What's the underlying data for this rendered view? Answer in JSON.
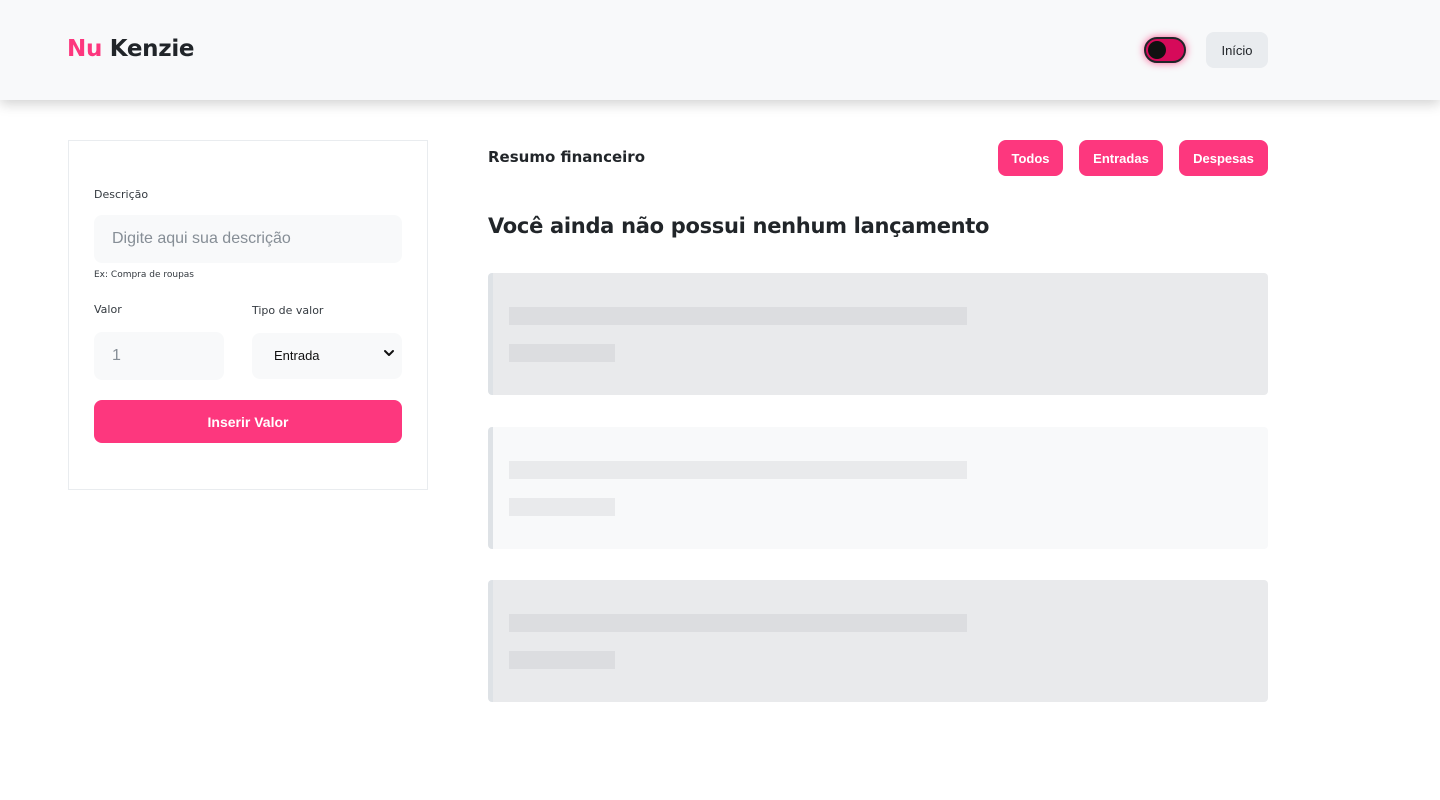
{
  "header": {
    "logo_primary": "Nu",
    "logo_secondary": "Kenzie",
    "theme_toggle_icon": "toggle-switch-icon",
    "home_button_label": "Início"
  },
  "form": {
    "description_label": "Descrição",
    "description_placeholder": "Digite aqui sua descrição",
    "description_hint": "Ex: Compra de roupas",
    "value_label": "Valor",
    "value_placeholder": "1",
    "type_label": "Tipo de valor",
    "type_selected": "Entrada",
    "submit_label": "Inserir Valor"
  },
  "summary": {
    "title": "Resumo financeiro",
    "filters": [
      "Todos",
      "Entradas",
      "Despesas"
    ],
    "empty_message": "Você ainda não possui nenhum lançamento"
  },
  "colors": {
    "accent": "#fd377e",
    "header_bg": "#f8f9fa",
    "skeleton_bg": "#e9eaec"
  }
}
